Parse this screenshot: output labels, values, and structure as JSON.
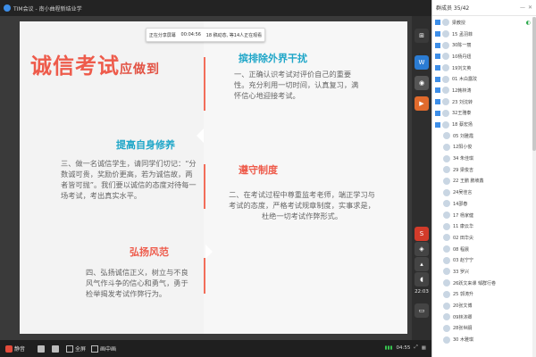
{
  "titlebar": {
    "title": "TIM会议 - 南小曲程新结业学"
  },
  "share": {
    "status": "正在分享屏幕",
    "timer": "00:04:56",
    "viewers": "18 稿动态, 等14人正在观看"
  },
  "slide": {
    "title_main": "诚信考试",
    "title_sub": "应做到",
    "sections": [
      {
        "title": "提高自身修养",
        "text": "三、做一名诚信学生，请同学们切记：“分数诚可贵，奖励价更高，若为诚信故，两者皆可抛”。我们要以诚信的态度对待每一场考试，考出真实水平。"
      },
      {
        "title": "弘扬风范",
        "text": "四、弘扬诚信正义，树立与不良风气作斗争的信心和勇气，勇于检举揭发考试作弊行为。"
      },
      {
        "title": "摈排除外界干扰",
        "text": "一、正确认识考试对评价自己的重要性。充分利用一切时间，认真复习，满怀信心地迎接考试。"
      },
      {
        "title": "遵守制度",
        "text": "二、在考试过程中尊重监考老师，端正学习与考试的态度，严格考试规章制度，实事求是，杜绝一切考试作弊形式。"
      }
    ]
  },
  "toolstrip": {
    "time": "22:03"
  },
  "bottombar": {
    "mute": "静音",
    "share": "全屏",
    "more": "画中画",
    "right_time": "04:55"
  },
  "panel": {
    "header": "群成员 35/42",
    "members": [
      {
        "name": "梁教授",
        "type": "t1",
        "color": "#3d8ee8",
        "mic": "◐"
      },
      {
        "name": "15 孟羽菲",
        "type": "t1",
        "color": "#3d8ee8"
      },
      {
        "name": "30陈一丽",
        "type": "t1",
        "color": "#3d8ee8"
      },
      {
        "name": "10杨丹妞",
        "type": "t1",
        "color": "#3d8ee8"
      },
      {
        "name": "19刘文英",
        "type": "t1",
        "color": "#3d8ee8"
      },
      {
        "name": "01 木白露玟",
        "type": "t1",
        "color": "#3d8ee8"
      },
      {
        "name": "12韩林涛",
        "type": "t1",
        "color": "#3d8ee8"
      },
      {
        "name": "23 刘沈转",
        "type": "t1",
        "color": "#3d8ee8"
      },
      {
        "name": "32王雅泰",
        "type": "t1",
        "color": "#3d8ee8"
      },
      {
        "name": "18 蔡宏扬",
        "type": "t1",
        "color": "#3d8ee8"
      },
      {
        "name": "05 刘雅霞",
        "type": "t2",
        "color": "#a7b7c9"
      },
      {
        "name": "12阳小俊",
        "type": "t2",
        "color": "#a7b7c9"
      },
      {
        "name": "34 朱佳琪",
        "type": "t2",
        "color": "#a7b7c9"
      },
      {
        "name": "29 梁俊吉",
        "type": "t2",
        "color": "#a7b7c9"
      },
      {
        "name": "22 王鹏 鹏坡鑫",
        "type": "t2",
        "color": "#a7b7c9"
      },
      {
        "name": "24吴佳言",
        "type": "t2",
        "color": "#a7b7c9"
      },
      {
        "name": "14邵春",
        "type": "t2",
        "color": "#a7b7c9"
      },
      {
        "name": "17 杨家健",
        "type": "t2",
        "color": "#a7b7c9"
      },
      {
        "name": "11 康云华",
        "type": "t2",
        "color": "#a7b7c9"
      },
      {
        "name": "02 田华尖",
        "type": "t2",
        "color": "#a7b7c9"
      },
      {
        "name": "08 程晨",
        "type": "t2",
        "color": "#a7b7c9"
      },
      {
        "name": "03 赵宁宁",
        "type": "t2",
        "color": "#a7b7c9"
      },
      {
        "name": "33 罗兴",
        "type": "t2",
        "color": "#a7b7c9"
      },
      {
        "name": "26跃文来课 邹群行卷",
        "type": "t2",
        "color": "#a7b7c9"
      },
      {
        "name": "25 郭涛升",
        "type": "t2",
        "color": "#a7b7c9"
      },
      {
        "name": "20张文博",
        "type": "t2",
        "color": "#a7b7c9"
      },
      {
        "name": "09林沐卿",
        "type": "t2",
        "color": "#a7b7c9"
      },
      {
        "name": "28张世嗣",
        "type": "t2",
        "color": "#a7b7c9"
      },
      {
        "name": "30 木雅琪",
        "type": "t2",
        "color": "#a7b7c9"
      }
    ]
  }
}
